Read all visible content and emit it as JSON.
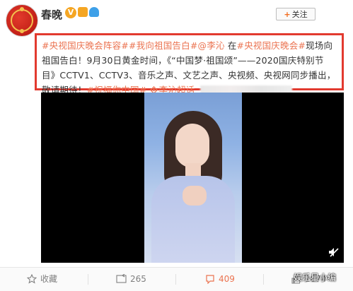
{
  "header": {
    "account_name": "春晚",
    "verify_badge": "V",
    "follow_plus": "+",
    "follow_label": "关注"
  },
  "post": {
    "tag_1": "#央视国庆晚会阵容#",
    "tag_2": "#我向祖国告白#",
    "mention": "@李沁",
    "text_in": "在",
    "tag_3": "#央视国庆晚会#",
    "text_body": "现场向祖国告白！9月30日黄金时间，《“中国梦·祖国颂”——2020国庆特别节目》CCTV1、CCTV3、音乐之声、文艺之声、央视频、央视网同步播出，敬请期待！",
    "tag_4": "#祝福你中国#",
    "supertopic_label": "李沁超话"
  },
  "actions": {
    "favorite_label": "收藏",
    "repost_count": "265",
    "comment_count": "409",
    "like_count": "2074"
  },
  "watermark": "娱乐星小编",
  "colors": {
    "accent": "#eb7350",
    "highlight_border": "#e23a2f",
    "verify": "#f5a623"
  },
  "icons": {
    "favorite": "star-outline-icon",
    "repost": "repost-icon",
    "comment": "comment-icon",
    "like": "thumbs-up-icon",
    "video": "mute-speaker-icon",
    "supertopic": "diamond-link-icon"
  }
}
